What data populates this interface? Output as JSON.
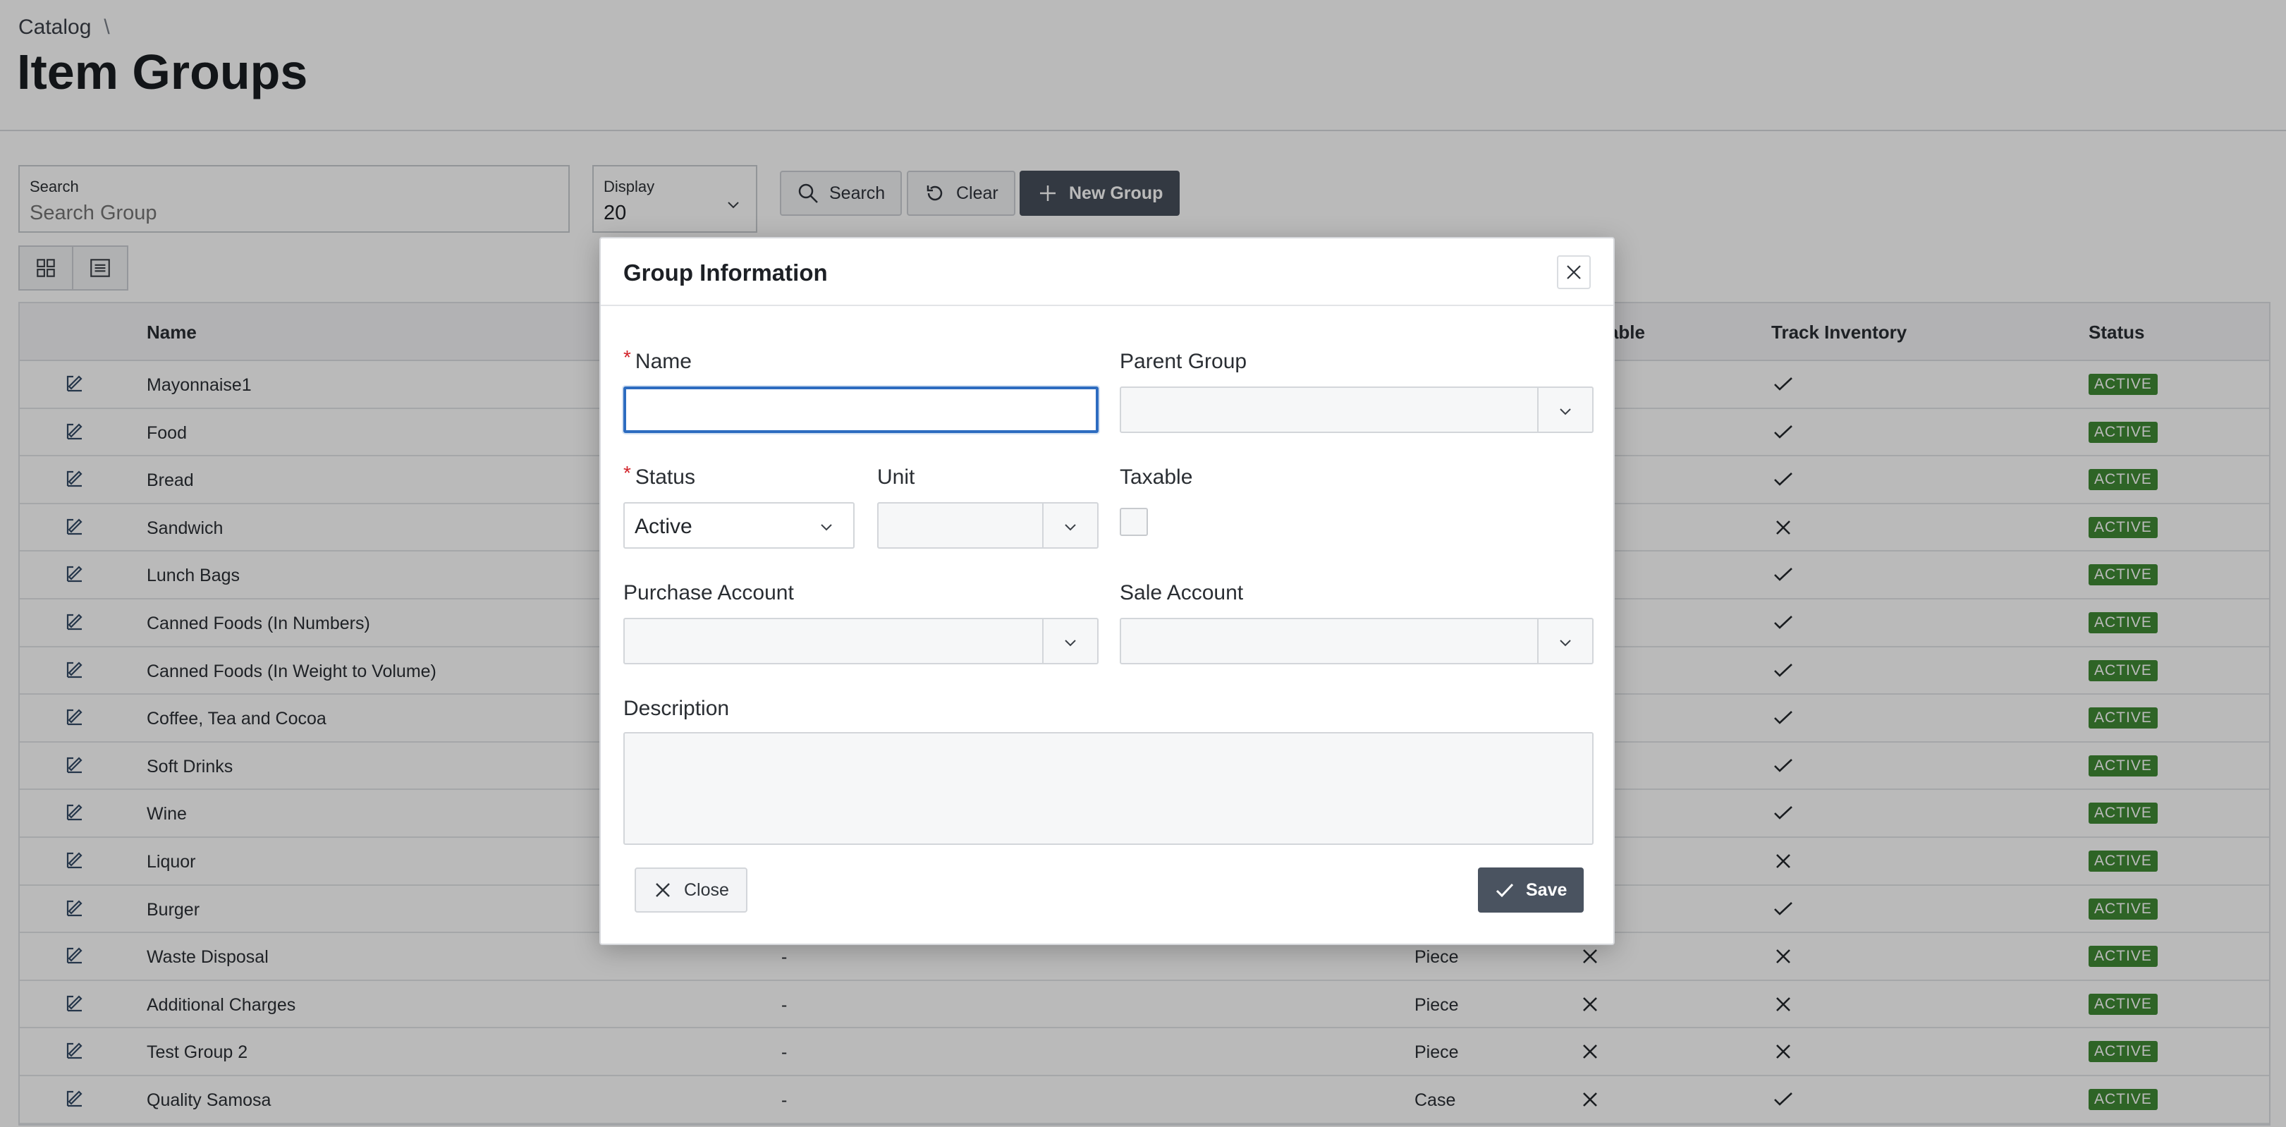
{
  "breadcrumb": {
    "parent": "Catalog",
    "separator": "\\"
  },
  "page_title": "Item Groups",
  "toolbar": {
    "search_label": "Search",
    "search_placeholder": "Search Group",
    "display_label": "Display",
    "display_value": "20",
    "search_button": "Search",
    "clear_button": "Clear",
    "new_group_button": "New Group"
  },
  "table": {
    "headers": {
      "name": "Name",
      "taxable": "Taxable",
      "track_inventory": "Track Inventory",
      "status": "Status"
    },
    "rows": [
      {
        "name": "Mayonnaise1",
        "parent": "",
        "unit": "",
        "taxable": "",
        "track": "check",
        "status": "ACTIVE"
      },
      {
        "name": "Food",
        "parent": "",
        "unit": "",
        "taxable": "",
        "track": "check",
        "status": "ACTIVE"
      },
      {
        "name": "Bread",
        "parent": "",
        "unit": "",
        "taxable": "",
        "track": "check",
        "status": "ACTIVE"
      },
      {
        "name": "Sandwich",
        "parent": "",
        "unit": "",
        "taxable": "",
        "track": "x",
        "status": "ACTIVE"
      },
      {
        "name": "Lunch Bags",
        "parent": "",
        "unit": "",
        "taxable": "",
        "track": "check",
        "status": "ACTIVE"
      },
      {
        "name": "Canned Foods (In Numbers)",
        "parent": "",
        "unit": "",
        "taxable": "",
        "track": "check",
        "status": "ACTIVE"
      },
      {
        "name": "Canned Foods (In Weight to Volume)",
        "parent": "",
        "unit": "",
        "taxable": "",
        "track": "check",
        "status": "ACTIVE"
      },
      {
        "name": "Coffee, Tea and Cocoa",
        "parent": "",
        "unit": "",
        "taxable": "",
        "track": "check",
        "status": "ACTIVE"
      },
      {
        "name": "Soft Drinks",
        "parent": "",
        "unit": "",
        "taxable": "",
        "track": "check",
        "status": "ACTIVE"
      },
      {
        "name": "Wine",
        "parent": "",
        "unit": "",
        "taxable": "",
        "track": "check",
        "status": "ACTIVE"
      },
      {
        "name": "Liquor",
        "parent": "",
        "unit": "",
        "taxable": "",
        "track": "x",
        "status": "ACTIVE"
      },
      {
        "name": "Burger",
        "parent": "",
        "unit": "",
        "taxable": "",
        "track": "check",
        "status": "ACTIVE"
      },
      {
        "name": "Waste Disposal",
        "parent": "-",
        "unit": "Piece",
        "taxable": "x",
        "track": "x",
        "status": "ACTIVE"
      },
      {
        "name": "Additional Charges",
        "parent": "-",
        "unit": "Piece",
        "taxable": "x",
        "track": "x",
        "status": "ACTIVE"
      },
      {
        "name": "Test Group 2",
        "parent": "-",
        "unit": "Piece",
        "taxable": "x",
        "track": "x",
        "status": "ACTIVE"
      },
      {
        "name": "Quality Samosa",
        "parent": "-",
        "unit": "Case",
        "taxable": "x",
        "track": "check",
        "status": "ACTIVE"
      }
    ]
  },
  "modal": {
    "title": "Group Information",
    "name_label": "Name",
    "name_value": "",
    "parent_group_label": "Parent Group",
    "parent_group_value": "",
    "status_label": "Status",
    "status_value": "Active",
    "unit_label": "Unit",
    "unit_value": "",
    "taxable_label": "Taxable",
    "purchase_account_label": "Purchase Account",
    "sale_account_label": "Sale Account",
    "description_label": "Description",
    "close_button": "Close",
    "save_button": "Save",
    "required_marker": "*"
  },
  "colors": {
    "primary_button": "#474f5b",
    "focus": "#2d6cc0",
    "badge": "#3f8a35",
    "required": "#d2232a"
  }
}
